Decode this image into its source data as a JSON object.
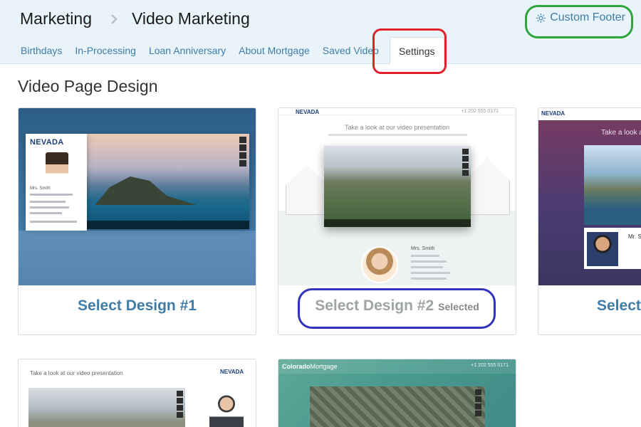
{
  "header": {
    "breadcrumb": [
      "Marketing",
      "Video Marketing"
    ],
    "tabs": [
      {
        "label": "Birthdays"
      },
      {
        "label": "In-Processing"
      },
      {
        "label": "Loan Anniversary"
      },
      {
        "label": "About Mortgage"
      },
      {
        "label": "Saved Video"
      },
      {
        "label": "Settings",
        "active": true
      }
    ],
    "custom_footer_label": "Custom Footer"
  },
  "main": {
    "section_title": "Video Page Design",
    "designs": [
      {
        "select_label": "Select Design #1",
        "selected": false
      },
      {
        "select_label": "Select Design #2",
        "selected": true,
        "selected_label": "Selected"
      },
      {
        "select_label": "Select",
        "selected": false
      }
    ],
    "thumbnails": {
      "t1": {
        "logo": "NEVADA",
        "name": "Mrs. Smith"
      },
      "t2": {
        "logo": "NEVADA",
        "phone": "+1 202 555 0171",
        "headline": "Take a look at our video presentation",
        "name": "Mrs. Smith"
      },
      "t3": {
        "logo": "NEVADA",
        "headline": "Take a look at",
        "name": "Mr. S"
      },
      "t4": {
        "headline": "Take a look at our video presentation",
        "logo": "NEVADA"
      },
      "t5": {
        "logo_bold": "Colorado",
        "logo_rest": "Mortgage",
        "phone": "+1 202 555 0171"
      }
    }
  },
  "colors": {
    "link": "#3f7ca8",
    "header_bg": "#e9f4fa",
    "annotation_red": "#e0212b",
    "annotation_green": "#2ea43a",
    "annotation_blue": "#3233b8"
  }
}
